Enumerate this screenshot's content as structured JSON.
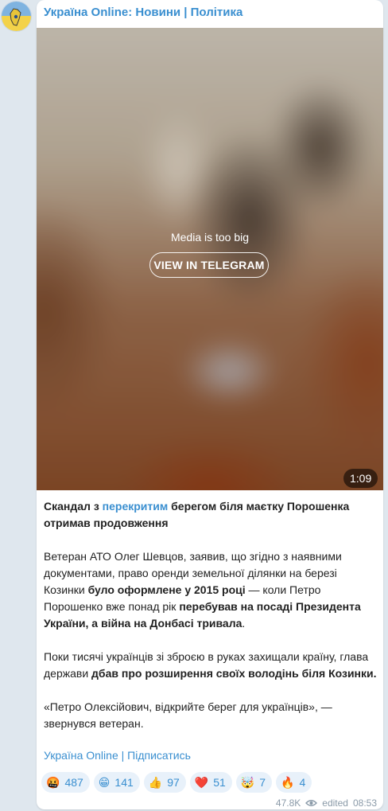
{
  "channel": {
    "name": "Україна Online: Новини | Політика"
  },
  "media": {
    "caption": "Media is too big",
    "view_button": "VIEW IN TELEGRAM",
    "duration": "1:09"
  },
  "post": {
    "p1": {
      "a": "Скандал з ",
      "link": "перекритим",
      "b": " берегом біля маєтку Порошенка отримав продовження"
    },
    "p2": {
      "a": "Ветеран АТО Олег Шевцов, заявив, що згідно з наявними документами, право оренди земельної ділянки на березі Козинки ",
      "b1": "було оформлене у 2015 році",
      "c": " — коли Петро Порошенко вже понад рік ",
      "b2": "перебував на посаді Президента України, а війна на Донбасі тривала",
      "d": "."
    },
    "p3": {
      "a": "Поки тисячі українців зі зброєю в руках захищали країну, глава держави ",
      "b": "дбав про розширення своїх володінь біля Козинки."
    },
    "p4": "«Петро Олексійович, відкрийте берег для українців», — звернувся ветеран.",
    "signature": "Україна Online | Підписатись"
  },
  "reactions": [
    {
      "emoji": "🤬",
      "icon": "angry-face-icon",
      "count": "487"
    },
    {
      "emoji": "😁",
      "icon": "grinning-face-icon",
      "count": "141"
    },
    {
      "emoji": "👍",
      "icon": "thumbs-up-icon",
      "count": "97"
    },
    {
      "emoji": "❤️",
      "icon": "red-heart-icon",
      "count": "51"
    },
    {
      "emoji": "🤯",
      "icon": "exploding-head-icon",
      "count": "7"
    },
    {
      "emoji": "🔥",
      "icon": "fire-icon",
      "count": "4"
    }
  ],
  "meta": {
    "views": "47.8K",
    "edited": "edited",
    "time": "08:53"
  },
  "colors": {
    "link": "#3a8fd0",
    "background": "#dfe7ee",
    "reaction_bg": "#e8f1fa"
  }
}
